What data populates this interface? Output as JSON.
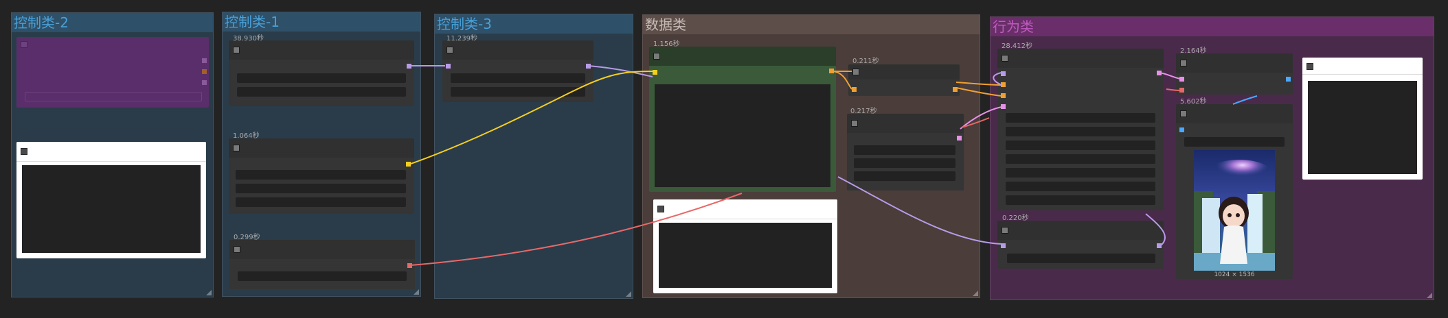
{
  "groups": [
    {
      "title": "控制类-2"
    },
    {
      "title": "控制类-1"
    },
    {
      "title": "控制类-3"
    },
    {
      "title": "数据类"
    },
    {
      "title": "行为类"
    }
  ],
  "timings": {
    "n1": "38.930秒",
    "n2": "1.064秒",
    "n3": "0.299秒",
    "n4": "11.239秒",
    "n5": "1.156秒",
    "n6": "0.211秒",
    "n7": "0.217秒",
    "n8": "28.412秒",
    "n9": "0.220秒",
    "n10": "2.164秒",
    "n11": "5.602秒"
  },
  "preview": {
    "size_label": "1024 × 1536"
  },
  "colors": {
    "group_control": "#2f4a5e",
    "group_data": "#4e3e3a",
    "group_behavior": "#5a2a5a",
    "link_lavender": "#b89be8",
    "link_yellow": "#f5cf1f",
    "link_red": "#e86868",
    "link_orange": "#f0a030",
    "link_pink": "#e890e8",
    "link_blue": "#4aa8ff"
  }
}
